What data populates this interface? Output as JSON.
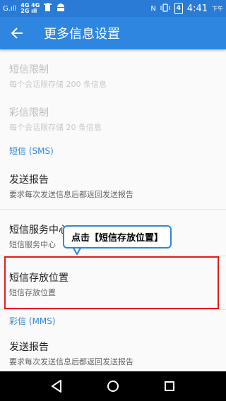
{
  "status_bar": {
    "signal1": "G.ıll",
    "signal2_top": "4G 4G",
    "signal2_bottom": "2G ıll",
    "battery_label": "4",
    "time": "4:41",
    "time_suffix": "下午"
  },
  "app_bar": {
    "back_icon": "back-arrow-icon",
    "title": "更多信息设置"
  },
  "sections": {
    "mms_limit_title": "短信限制",
    "mms_limit_summary": "每个会话限存储 200 条信息",
    "mms_limit2_title": "彩信限制",
    "mms_limit2_summary": "每个会话限存储 20 条信息",
    "sms_header": "短信 (SMS)",
    "send_report_title": "发送报告",
    "send_report_summary": "要求每次发送信息后都返回发送报告",
    "service_center_title": "短信服务中心",
    "service_center_summary": "短信服务中心",
    "storage_title": "短信存放位置",
    "storage_summary": "短信存放位置",
    "mms_header": "彩信 (MMS)",
    "mms_report_title": "发送报告",
    "mms_report_summary": "要求每次发送信息后都返回发送报告"
  },
  "annotation": {
    "tooltip_text": "点击【短信存放位置】"
  },
  "colors": {
    "primary": "#2e86e0",
    "status_bar": "#2a7bd6",
    "highlight": "#e11d1d"
  },
  "nav": {
    "back": "nav-back-icon",
    "home": "nav-home-icon",
    "recents": "nav-recents-icon"
  }
}
